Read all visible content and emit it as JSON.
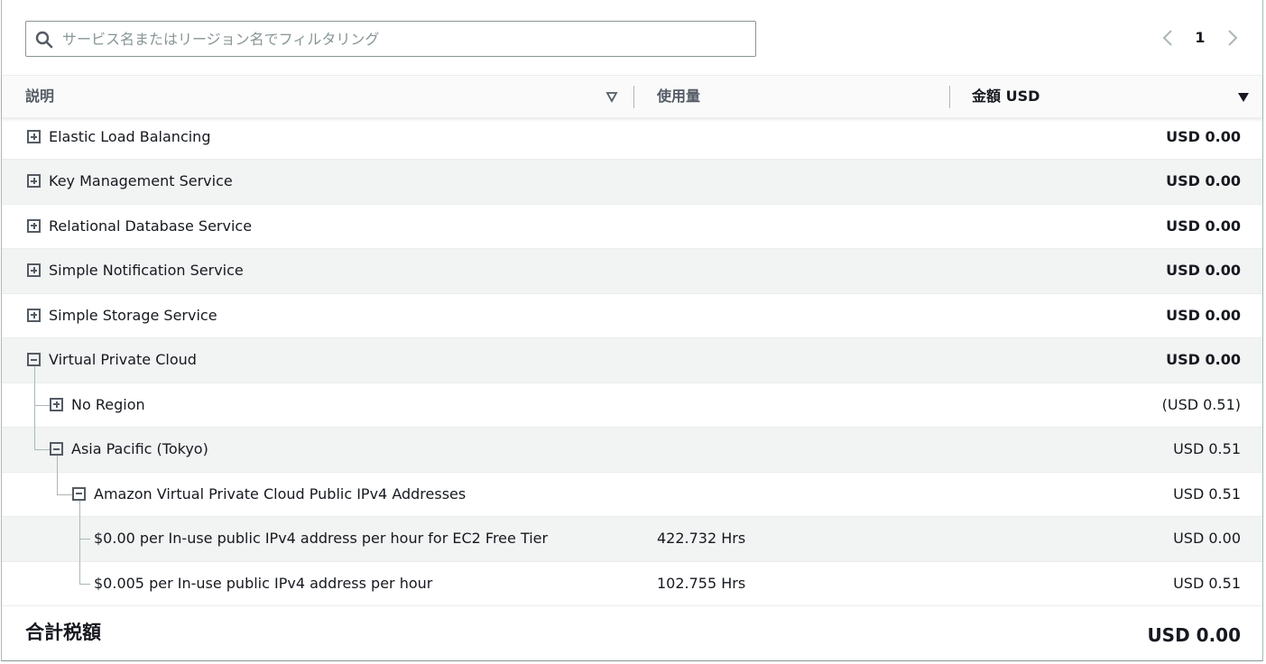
{
  "search": {
    "placeholder": "サービス名またはリージョン名でフィルタリング",
    "value": ""
  },
  "pagination": {
    "current_page": "1"
  },
  "table": {
    "columns": {
      "description": "説明",
      "usage": "使用量",
      "amount": "金額 USD"
    },
    "rows": [
      {
        "label": "Elastic Load Balancing",
        "usage": "",
        "amount": "USD 0.00"
      },
      {
        "label": "Key Management Service",
        "usage": "",
        "amount": "USD 0.00"
      },
      {
        "label": "Relational Database Service",
        "usage": "",
        "amount": "USD 0.00"
      },
      {
        "label": "Simple Notification Service",
        "usage": "",
        "amount": "USD 0.00"
      },
      {
        "label": "Simple Storage Service",
        "usage": "",
        "amount": "USD 0.00"
      },
      {
        "label": "Virtual Private Cloud",
        "usage": "",
        "amount": "USD 0.00"
      },
      {
        "label": "No Region",
        "usage": "",
        "amount": "(USD 0.51)"
      },
      {
        "label": "Asia Pacific (Tokyo)",
        "usage": "",
        "amount": "USD 0.51"
      },
      {
        "label": "Amazon Virtual Private Cloud Public IPv4 Addresses",
        "usage": "",
        "amount": "USD 0.51"
      },
      {
        "label": "$0.00 per In-use public IPv4 address per hour for EC2 Free Tier",
        "usage": "422.732 Hrs",
        "amount": "USD 0.00"
      },
      {
        "label": "$0.005 per In-use public IPv4 address per hour",
        "usage": "102.755 Hrs",
        "amount": "USD 0.51"
      }
    ]
  },
  "total": {
    "label": "合計税額",
    "value": "USD 0.00"
  },
  "colors": {
    "border": "#aab7b8",
    "row_alt": "#f2f3f3",
    "text": "#16191f",
    "muted": "#545b64"
  }
}
